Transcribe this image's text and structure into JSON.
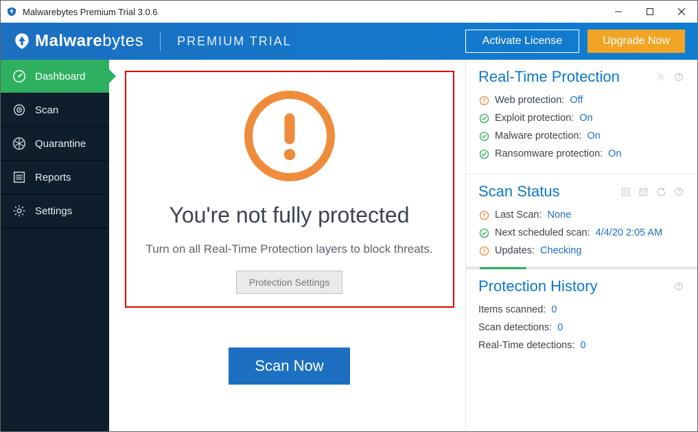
{
  "window": {
    "title": "Malwarebytes Premium Trial 3.0.6"
  },
  "header": {
    "brand_main_bold": "Malware",
    "brand_main_rest": "bytes",
    "brand_sub": "PREMIUM TRIAL",
    "activate_label": "Activate License",
    "upgrade_label": "Upgrade Now"
  },
  "sidebar": {
    "items": [
      {
        "label": "Dashboard"
      },
      {
        "label": "Scan"
      },
      {
        "label": "Quarantine"
      },
      {
        "label": "Reports"
      },
      {
        "label": "Settings"
      }
    ]
  },
  "hero": {
    "title": "You're not fully protected",
    "subtitle": "Turn on all Real-Time Protection layers to block threats.",
    "protection_settings_label": "Protection Settings",
    "scan_now_label": "Scan Now"
  },
  "realtime": {
    "title": "Real-Time Protection",
    "items": [
      {
        "label": "Web protection:",
        "value": "Off",
        "status": "warn"
      },
      {
        "label": "Exploit protection:",
        "value": "On",
        "status": "ok"
      },
      {
        "label": "Malware protection:",
        "value": "On",
        "status": "ok"
      },
      {
        "label": "Ransomware protection:",
        "value": "On",
        "status": "ok"
      }
    ]
  },
  "scan_status": {
    "title": "Scan Status",
    "items": [
      {
        "label": "Last Scan:",
        "value": "None",
        "status": "warn"
      },
      {
        "label": "Next scheduled scan:",
        "value": "4/4/20 2:05 AM",
        "status": "ok"
      },
      {
        "label": "Updates:",
        "value": "Checking",
        "status": "warn"
      }
    ]
  },
  "history": {
    "title": "Protection History",
    "items": [
      {
        "label": "Items scanned:",
        "value": "0"
      },
      {
        "label": "Scan detections:",
        "value": "0"
      },
      {
        "label": "Real-Time detections:",
        "value": "0"
      }
    ]
  },
  "colors": {
    "accent_blue": "#1c6fc1",
    "accent_green": "#2eb060",
    "accent_orange": "#ee8c3c",
    "upgrade_orange": "#f2a525",
    "danger_red": "#e40000"
  }
}
